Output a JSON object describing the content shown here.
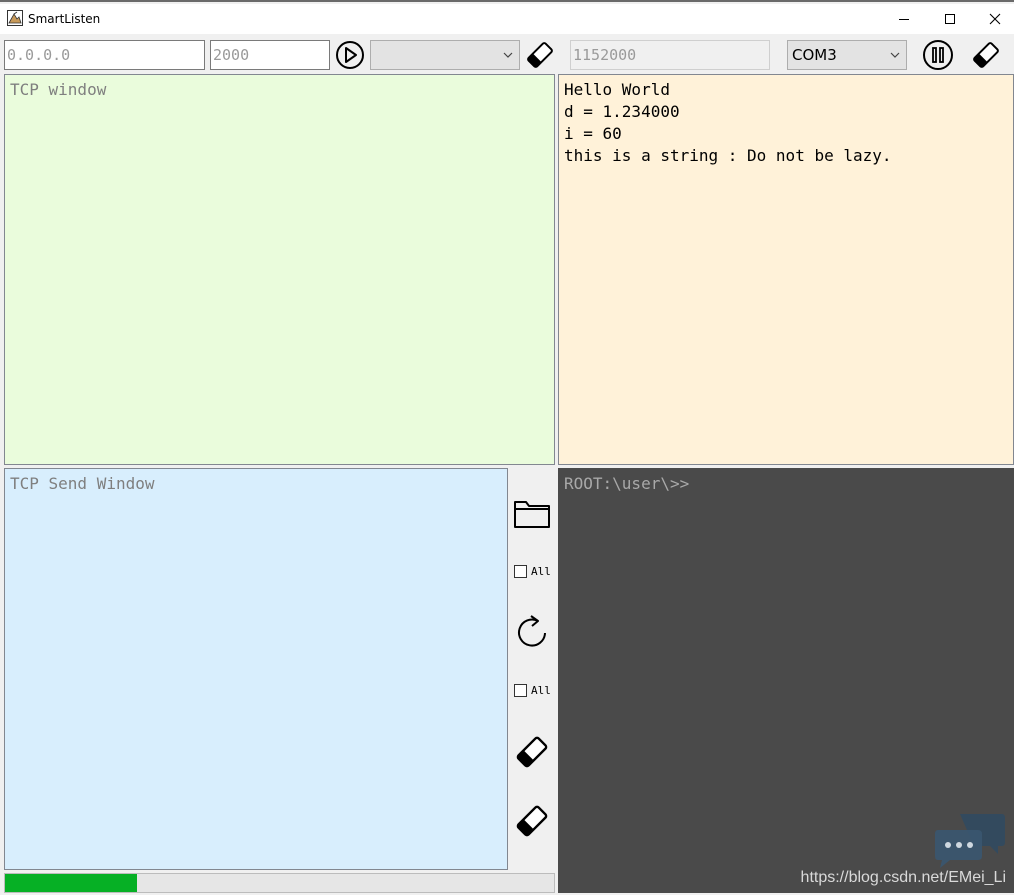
{
  "window": {
    "title": "SmartListen",
    "controls": [
      "minimize",
      "maximize",
      "close"
    ]
  },
  "toolbar": {
    "ip_address": "0.0.0.0",
    "port": "2000",
    "tcp_client_select": "",
    "baud_rate": "1152000",
    "com_port": "COM3",
    "icons": {
      "connect": "play-circle-icon",
      "clear_tcp": "eraser-icon",
      "pause": "pause-circle-icon",
      "clear_serial": "eraser-icon"
    }
  },
  "tcp_window": {
    "placeholder": "TCP window"
  },
  "serial_window": {
    "lines": [
      "Hello World",
      "d = 1.234000",
      "i = 60",
      "this is a string : Do not be lazy."
    ]
  },
  "tcp_send_window": {
    "placeholder": "TCP Send Window"
  },
  "side_controls": {
    "open_file_icon": "folder-icon",
    "all_label_1": "All",
    "repeat_icon": "refresh-icon",
    "all_label_2": "All",
    "clear_send_icon": "eraser-icon",
    "clear_all_icon": "eraser-icon"
  },
  "terminal": {
    "prompt": "ROOT:\\user\\>>"
  },
  "progress": {
    "fraction": 0.24
  },
  "watermark": {
    "text": "https://blog.csdn.net/EMei_Li"
  },
  "colors": {
    "tcp_window_bg": "#eafcdc",
    "serial_window_bg": "#fff2d9",
    "send_window_bg": "#d8eefd",
    "terminal_bg": "#4a4a4a",
    "progress_fill": "#06b025"
  }
}
